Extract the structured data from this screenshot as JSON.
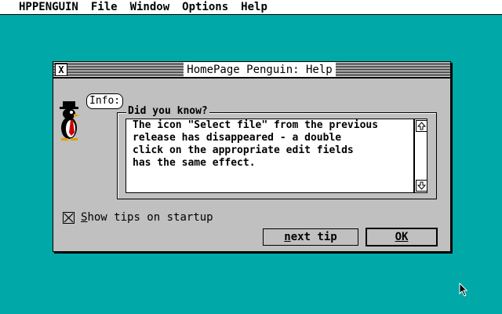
{
  "menubar": {
    "items": [
      "HPPENGUIN",
      "File",
      "Window",
      "Options",
      "Help"
    ]
  },
  "dialog": {
    "title": "HomePage Penguin: Help",
    "mascot_bubble": "Info:",
    "group_label": "Did you know?",
    "tip_lines": [
      "The icon \"Select file\" from the previous",
      "release has disappeared - a double",
      "click on the appropriate edit fields",
      "has the same effect."
    ],
    "show_tips_label_first": "S",
    "show_tips_label_rest": "how tips on startup",
    "show_tips_checked": true,
    "next_tip_first": "n",
    "next_tip_rest": "ext tip",
    "ok_label": "OK"
  },
  "colors": {
    "desktop": "#00a8a8",
    "window": "#c0c0c0",
    "accent_red": "#cc0000"
  },
  "icons": {
    "close": "close-icon",
    "scroll_up": "scroll-up-icon",
    "scroll_down": "scroll-down-icon",
    "mascot": "penguin-mascot-icon",
    "pointer": "mouse-pointer-icon"
  }
}
